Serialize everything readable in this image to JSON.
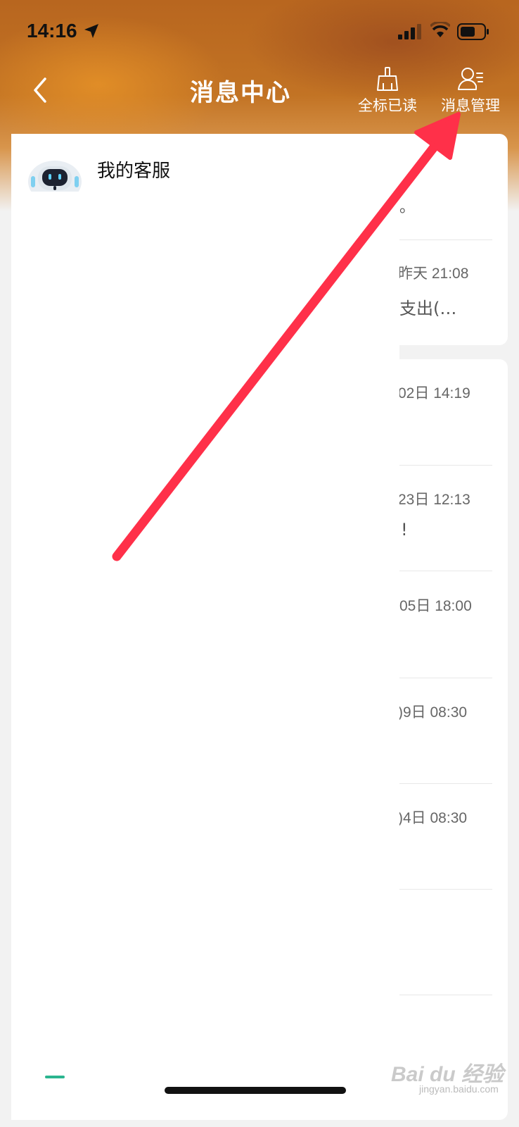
{
  "status_bar": {
    "time": "14:16"
  },
  "header": {
    "title": "消息中心",
    "actions": [
      {
        "label": "全标已读",
        "icon": "broom-icon"
      },
      {
        "label": "消息管理",
        "icon": "user-settings-icon"
      }
    ]
  },
  "service_card": {
    "name": "我的客服",
    "preview_tail": "。",
    "latest": {
      "time": "昨天 21:08",
      "preview": "支出(…"
    }
  },
  "messages": [
    {
      "time": "02日 14:19",
      "preview": ""
    },
    {
      "time": "23日 12:13",
      "preview": "!"
    },
    {
      "time": "05日 18:00",
      "preview": ""
    },
    {
      "time": ")9日 08:30",
      "preview": ""
    },
    {
      "time": ")4日 08:30",
      "preview": ""
    }
  ],
  "annotation": {
    "arrow_color": "#ff3049"
  },
  "watermark": {
    "brand": "Bai du 经验",
    "url": "jingyan.baidu.com"
  }
}
